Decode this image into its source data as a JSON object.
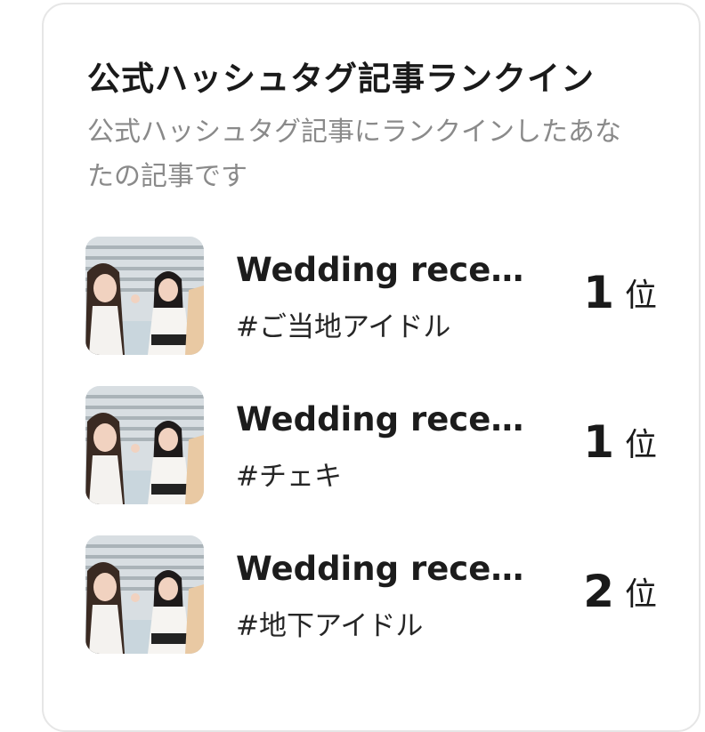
{
  "panel": {
    "title": "公式ハッシュタグ記事ランクイン",
    "description": "公式ハッシュタグ記事にランクインしたあなたの記事です"
  },
  "rankings": [
    {
      "title": "Wedding rece…",
      "hashtag": "#ご当地アイドル",
      "rank": "1",
      "rank_unit": "位",
      "thumbnail": "photo-two-girls-icon"
    },
    {
      "title": "Wedding rece…",
      "hashtag": "#チェキ",
      "rank": "1",
      "rank_unit": "位",
      "thumbnail": "photo-two-girls-icon"
    },
    {
      "title": "Wedding rece…",
      "hashtag": "#地下アイドル",
      "rank": "2",
      "rank_unit": "位",
      "thumbnail": "photo-two-girls-icon"
    }
  ]
}
